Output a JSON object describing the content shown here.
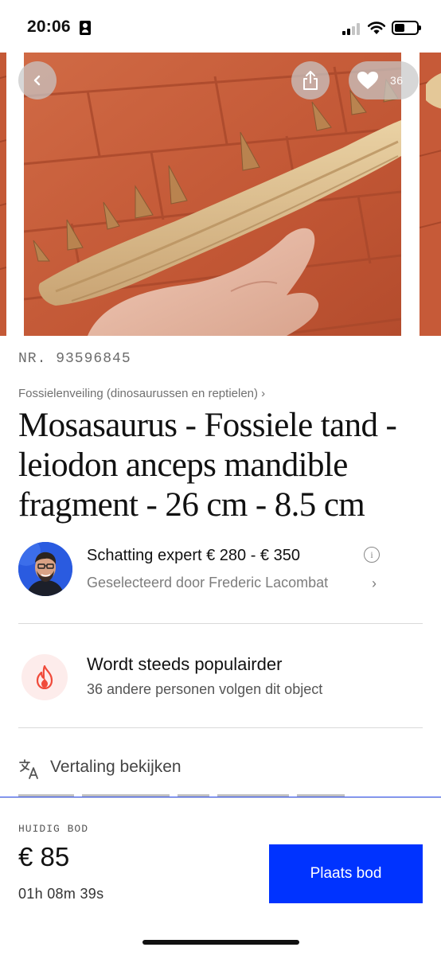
{
  "status_bar": {
    "time": "20:06"
  },
  "gallery": {
    "favorite_count": "36",
    "image_subject": "mosasaurus jaw fragment held in hand over brick background",
    "icons": {
      "back": "chevron-left-icon",
      "share": "share-icon",
      "favorite": "heart-icon"
    }
  },
  "lot": {
    "number": "NR. 93596845",
    "breadcrumb": "Fossielenveiling (dinosaurussen en reptielen) ›",
    "title": "Mosasaurus - Fossiele tand - leiodon anceps mandible fragment - 26 cm - 8.5 cm"
  },
  "expert": {
    "estimate": "Schatting expert € 280 - € 350",
    "selected_by": "Geselecteerd door Frederic Lacombat",
    "chevron": "›"
  },
  "popularity": {
    "title": "Wordt steeds populairder",
    "subtitle": "36 andere personen volgen dit object"
  },
  "translation": {
    "label": "Vertaling bekijken"
  },
  "bid": {
    "label": "HUIDIG BOD",
    "amount": "€ 85",
    "time_left": "01h 08m 39s",
    "button_label": "Plaats bod"
  },
  "colors": {
    "accent": "#0033ff",
    "fire": "#f04a3a",
    "fire_bg": "#fdeceb",
    "brick": "#c65b39"
  }
}
